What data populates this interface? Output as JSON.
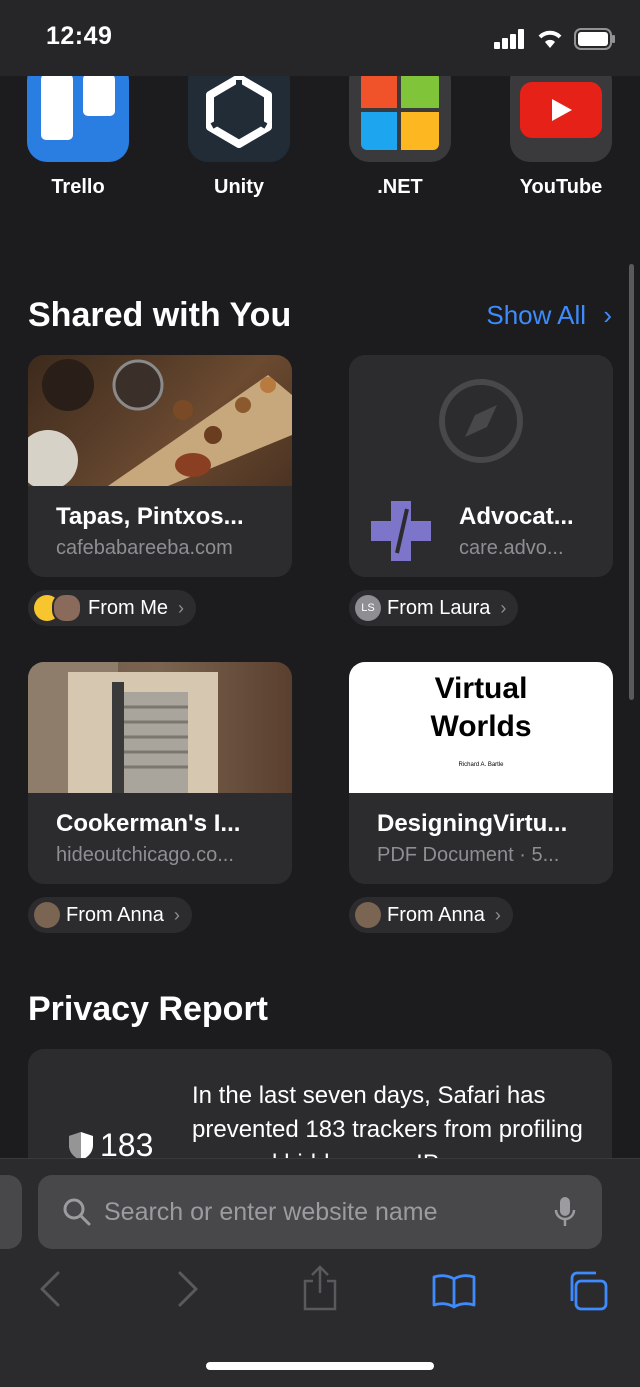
{
  "status": {
    "time": "12:49"
  },
  "favorites": [
    {
      "label": "Trello",
      "icon": "trello-icon"
    },
    {
      "label": "Unity",
      "icon": "unity-icon"
    },
    {
      "label": ".NET",
      "icon": "dotnet-icon"
    },
    {
      "label": "YouTube",
      "icon": "youtube-icon"
    }
  ],
  "shared": {
    "title": "Shared with You",
    "show_all": "Show All",
    "cards": [
      {
        "title": "Tapas, Pintxos...",
        "subtitle": "cafebabareeba.com",
        "from": "From Me"
      },
      {
        "title": "Advocat...",
        "subtitle": "care.advo...",
        "from": "From Laura",
        "avatar_initials": "LS"
      },
      {
        "title": "Cookerman's I...",
        "subtitle": "hideoutchicago.co...",
        "from": "From Anna"
      },
      {
        "title": "DesigningVirtu...",
        "subtitle": "PDF Document · 5...",
        "from": "From Anna",
        "preview": {
          "line1": "Virtual",
          "line2": "Worlds",
          "author": "Richard A. Bartle"
        }
      }
    ]
  },
  "privacy": {
    "title": "Privacy Report",
    "count": "183",
    "text": "In the last seven days, Safari has prevented 183 trackers from profiling you and hidden your IP"
  },
  "search": {
    "placeholder": "Search or enter website name"
  },
  "colors": {
    "accent": "#3d8bfd",
    "background": "#1c1c1e",
    "card": "#2c2c2e"
  }
}
